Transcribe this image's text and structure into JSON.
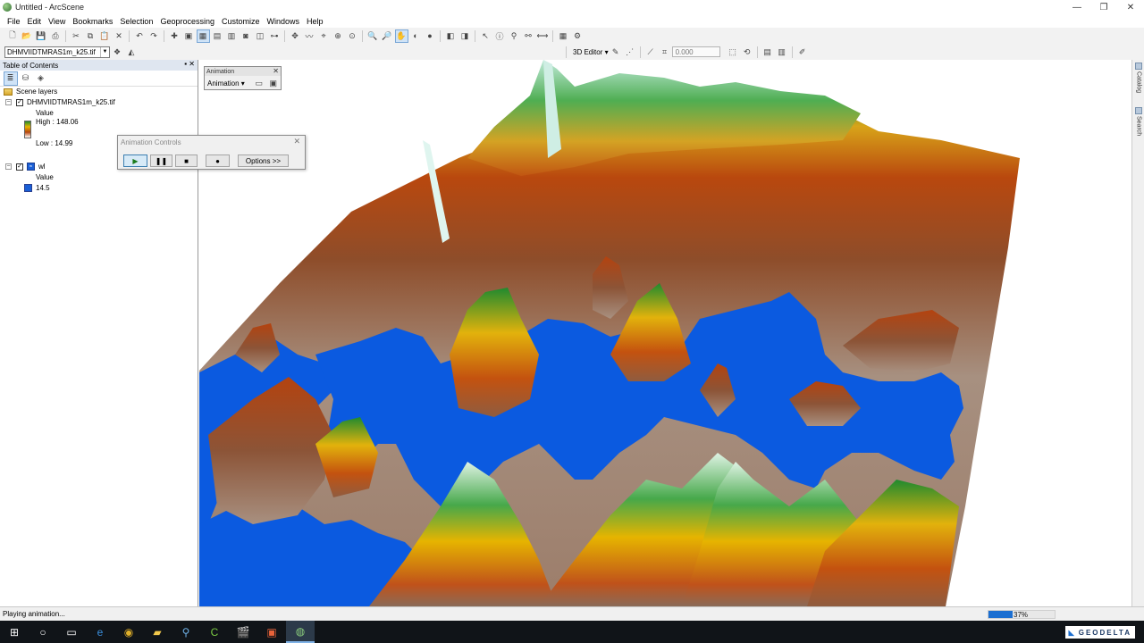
{
  "window": {
    "title": "Untitled - ArcScene",
    "minimize": "—",
    "maximize": "❐",
    "close": "✕"
  },
  "menu": [
    "File",
    "Edit",
    "View",
    "Bookmarks",
    "Selection",
    "Geoprocessing",
    "Customize",
    "Windows",
    "Help"
  ],
  "toolbar": {
    "layer_dropdown": "DHMVIIDTMRAS1m_k25.tif",
    "editor_label": "3D Editor ▾",
    "offset_value": "0.000"
  },
  "toc": {
    "title": "Table of Contents",
    "header_buttons": "▪ ✕",
    "scene_layers": "Scene layers",
    "layer1": {
      "name": "DHMVIIDTMRAS1m_k25.tif",
      "value_label": "Value",
      "high": "High : 148.06",
      "low": "Low : 14.99"
    },
    "layer2": {
      "name": "wl",
      "value_label": "Value",
      "class_value": "14.5"
    }
  },
  "animation_toolbar": {
    "title": "Animation",
    "menu_label": "Animation ▾"
  },
  "animation_controls": {
    "title": "Animation Controls",
    "play": "▶",
    "pause": "❚❚",
    "stop": "■",
    "record": "●",
    "options": "Options >>"
  },
  "right_dock": {
    "catalog": "Catalog",
    "search": "Search"
  },
  "status": {
    "text": "Playing animation...",
    "progress_label": "37%",
    "progress_fraction": 0.37
  },
  "taskbar": {
    "logo": "GEODELTA"
  },
  "colors": {
    "water": "#0b5ae0",
    "terrain_low": "#a88f80",
    "terrain_mid": "#b8450e",
    "terrain_high": "#2f9a32",
    "terrain_peak": "#e8f6e6"
  }
}
